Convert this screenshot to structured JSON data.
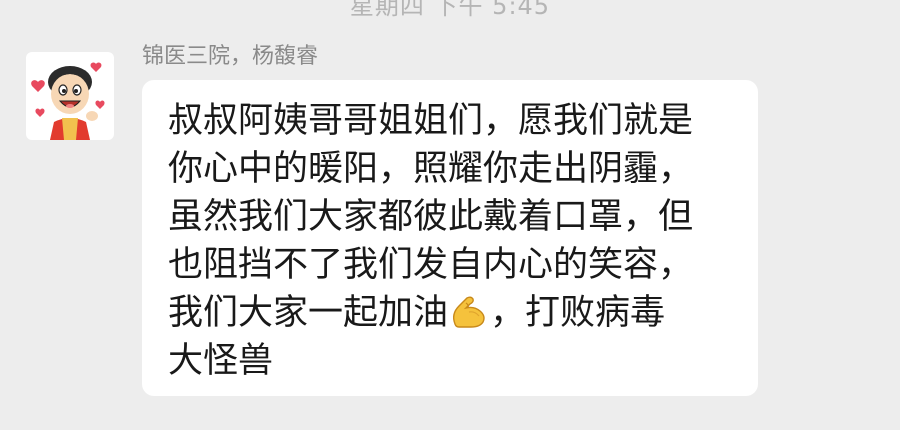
{
  "chat": {
    "timestamp": "星期四 下午 5:45",
    "sender_name": "锦医三院，杨馥睿",
    "message": {
      "lines": [
        "叔叔阿姨哥哥姐姐们，愿我们就是",
        "你心中的暖阳，照耀你走出阴霾，",
        "虽然我们大家都彼此戴着口罩，但",
        "也阻挡不了我们发自内心的笑容，",
        "大怪兽"
      ],
      "line5_before": "我们大家一起加油",
      "line5_after": "，打败病毒",
      "emoji": "flexed-biceps-icon"
    },
    "avatar_icon": "cartoon-boy-avatar"
  }
}
